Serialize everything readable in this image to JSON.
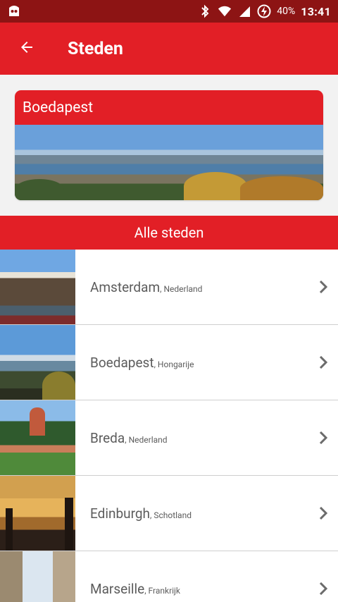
{
  "status_bar": {
    "battery": "40%",
    "time": "13:41",
    "icons": [
      "ghost-icon",
      "bluetooth-icon",
      "wifi-icon",
      "signal-icon",
      "battery-charging-icon"
    ]
  },
  "app_bar": {
    "title": "Steden",
    "back_icon": "arrow-back-icon"
  },
  "featured": {
    "title": "Boedapest"
  },
  "section": {
    "title": "Alle steden"
  },
  "cities": [
    {
      "name": "Amsterdam",
      "country": ", Nederland"
    },
    {
      "name": "Boedapest",
      "country": ", Hongarije"
    },
    {
      "name": "Breda",
      "country": ", Nederland"
    },
    {
      "name": "Edinburgh",
      "country": ", Schotland"
    },
    {
      "name": "Marseille",
      "country": ", Frankrijk"
    }
  ],
  "colors": {
    "primary": "#e21f26",
    "status_bar": "#8d1414",
    "background": "#f2f2f2",
    "text_secondary": "#5c5c5c"
  }
}
